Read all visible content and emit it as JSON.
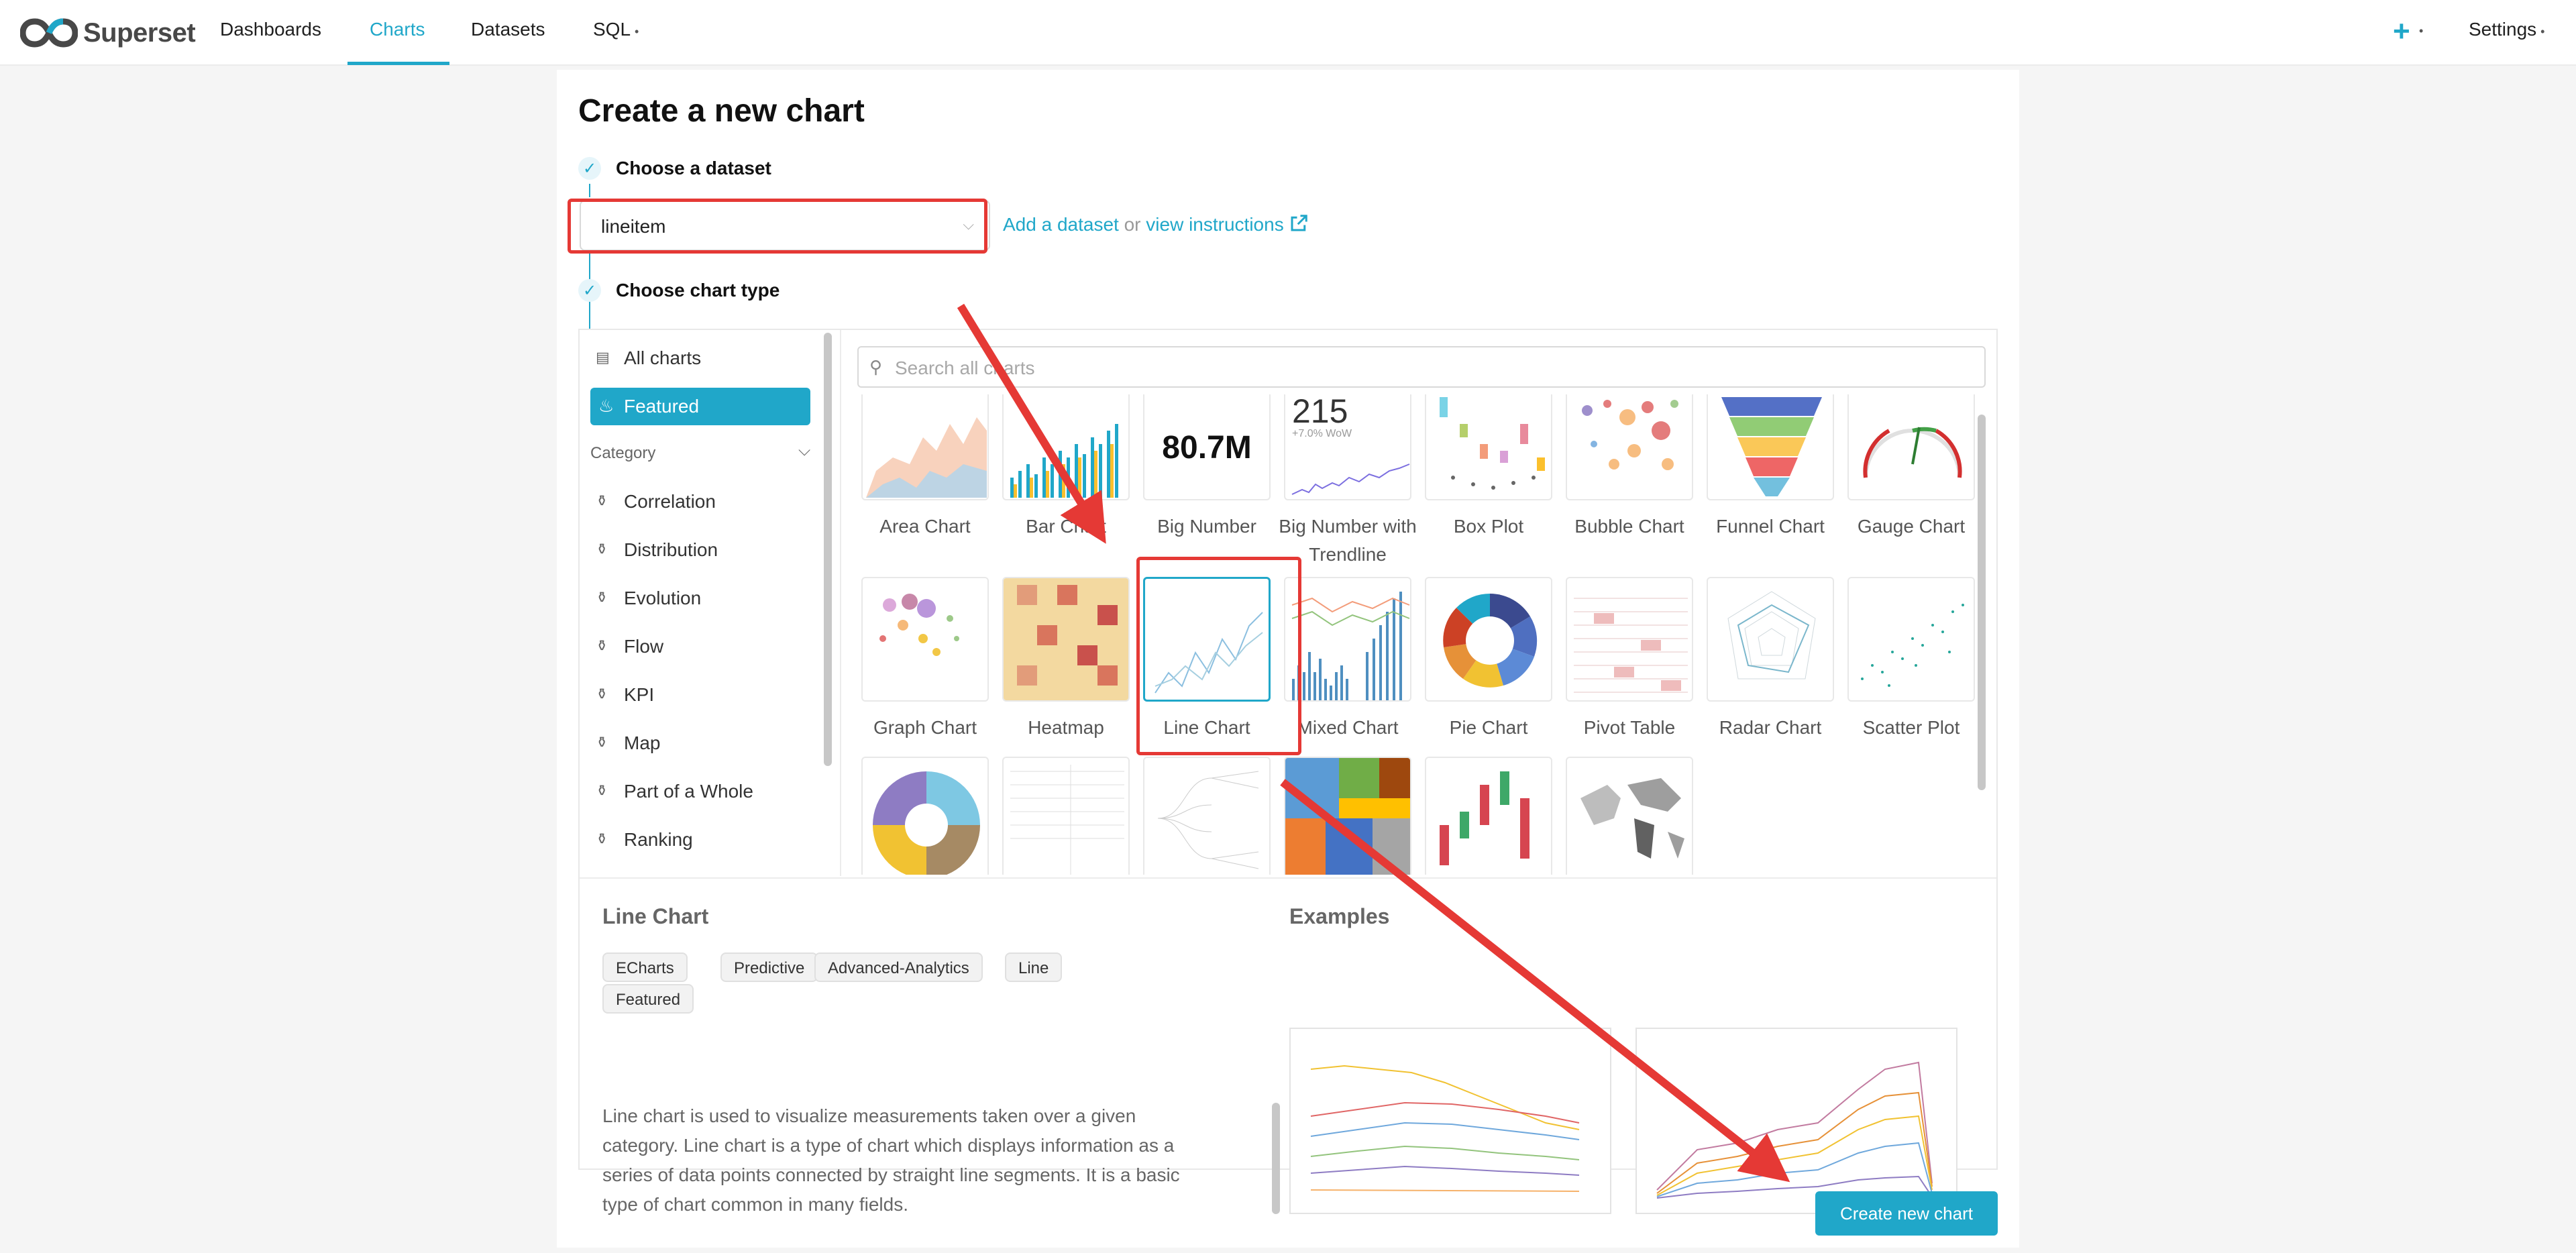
{
  "nav": {
    "brand": "Superset",
    "items": [
      "Dashboards",
      "Charts",
      "Datasets",
      "SQL"
    ],
    "active": "Charts",
    "plus": "+",
    "settings": "Settings"
  },
  "page": {
    "title": "Create a new chart",
    "step1_label": "Choose a dataset",
    "step2_label": "Choose chart type",
    "dataset_value": "lineitem",
    "add_dataset": "Add a dataset",
    "or_text": "or",
    "view_instructions": "view instructions"
  },
  "sidebar": {
    "all_charts": "All charts",
    "featured": "Featured",
    "category_heading": "Category",
    "categories": [
      "Correlation",
      "Distribution",
      "Evolution",
      "Flow",
      "KPI",
      "Map",
      "Part of a Whole",
      "Ranking"
    ]
  },
  "search": {
    "placeholder": "Search all charts"
  },
  "gallery": {
    "row1": [
      "Area Chart",
      "Bar Chart",
      "Big Number",
      "Big Number with Trendline",
      "Box Plot",
      "Bubble Chart",
      "Funnel Chart",
      "Gauge Chart"
    ],
    "row2": [
      "Graph Chart",
      "Heatmap",
      "Line Chart",
      "Mixed Chart",
      "Pie Chart",
      "Pivot Table",
      "Radar Chart",
      "Scatter Plot"
    ],
    "big_number_thumb": "80.7M",
    "trendline_thumb": "215",
    "trendline_sub": "+7.0% WoW",
    "selected": "Line Chart"
  },
  "detail": {
    "title": "Line Chart",
    "tags": [
      "ECharts",
      "Predictive",
      "Advanced-Analytics",
      "Line",
      "Featured"
    ],
    "description": "Line chart is used to visualize measurements taken over a given category. Line chart is a type of chart which displays information as a series of data points connected by straight line segments. It is a basic type of chart common in many fields.",
    "examples_title": "Examples"
  },
  "actions": {
    "create": "Create new chart"
  },
  "colors": {
    "accent": "#20a7c9",
    "annotation": "#e53935"
  },
  "icons": [
    "superset-logo-icon",
    "check-icon",
    "chevron-down-icon",
    "external-link-icon",
    "search-icon",
    "grid-icon",
    "fire-icon",
    "category-icon"
  ]
}
